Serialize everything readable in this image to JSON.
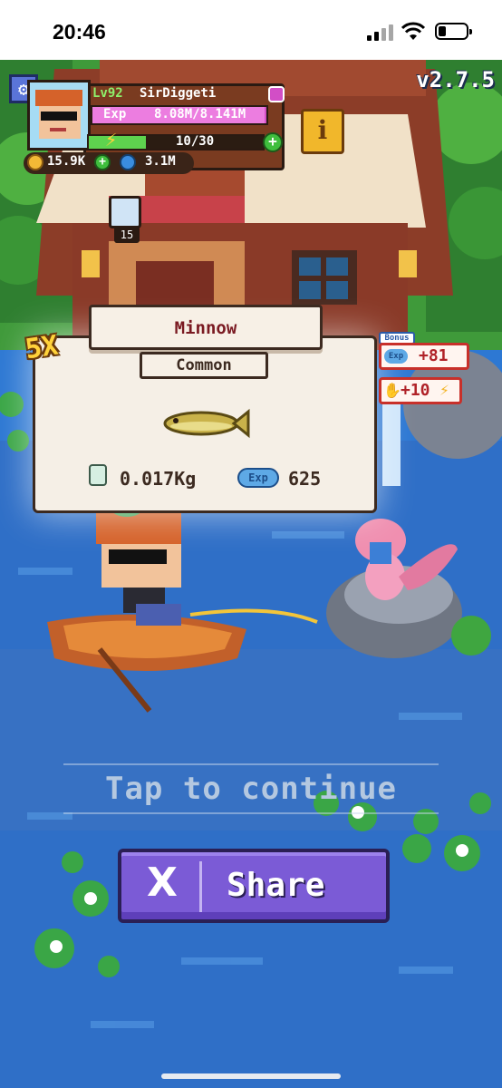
{
  "status_bar": {
    "time": "20:46"
  },
  "game": {
    "version": "v2.7.5",
    "player": {
      "level": "Lv92",
      "name": "SirDiggeti",
      "exp_label": "Exp",
      "exp_value": "8.08M/8.141M",
      "exp_fraction": 0.99,
      "energy_value": "10/30",
      "energy_fraction": 0.33,
      "coins": "15.9K",
      "gems": "3.1M"
    },
    "bait_count": "15",
    "catch": {
      "multiplier": "5X",
      "fish_name": "Minnow",
      "rarity": "Common",
      "weight": "0.017Kg",
      "exp_icon_label": "Exp",
      "exp_gain": "625"
    },
    "bonus": {
      "tag": "Bonus",
      "exp_icon_label": "Exp",
      "exp_bonus": "+81",
      "energy_bonus": "+10"
    },
    "tap_to_continue": "Tap to continue",
    "share_label": "Share",
    "colors": {
      "water": "#2d78d3",
      "share_button": "#7b5bd6",
      "fish_name": "#7a1a22",
      "bonus_text": "#b02228"
    }
  }
}
